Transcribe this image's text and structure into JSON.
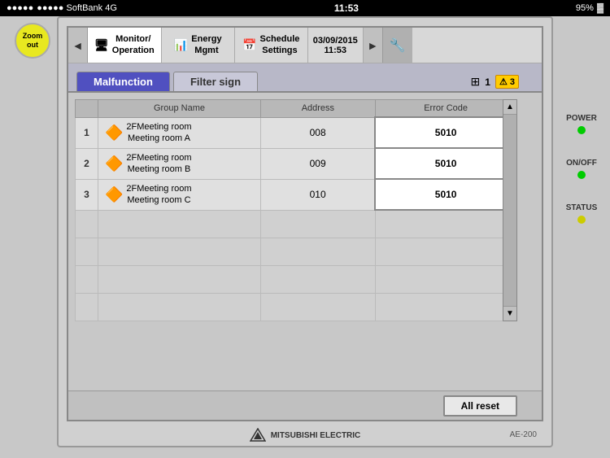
{
  "statusBar": {
    "carrier": "●●●●● SoftBank 4G",
    "time": "11:53",
    "battery": "95%"
  },
  "zoomOut": {
    "label": "Zoom\nout"
  },
  "nav": {
    "prevArrow": "◄",
    "nextArrow": "►",
    "tabs": [
      {
        "id": "monitor",
        "icon": "🖥",
        "label": "Monitor/\nOperation"
      },
      {
        "id": "energy",
        "icon": "📊",
        "label": "Energy\nMgmt"
      },
      {
        "id": "schedule",
        "icon": "📅",
        "label": "Schedule\nSettings"
      }
    ],
    "date": "03/09/2015",
    "time": "11:53",
    "wrenchIcon": "🔧"
  },
  "subTabs": {
    "tabs": [
      {
        "id": "malfunction",
        "label": "Malfunction",
        "active": true
      },
      {
        "id": "filtersign",
        "label": "Filter sign",
        "active": false
      }
    ],
    "gridIcon": "⊞",
    "gridCount": "1",
    "warningIcon": "⚠",
    "warningCount": "3"
  },
  "table": {
    "headers": [
      "Group Name",
      "Address",
      "Error Code"
    ],
    "rows": [
      {
        "num": "1",
        "groupLine1": "2FMeeting room",
        "groupLine2": "Meeting room A",
        "address": "008",
        "errorCode": "5010",
        "hasWarning": true
      },
      {
        "num": "2",
        "groupLine1": "2FMeeting room",
        "groupLine2": "Meeting room B",
        "address": "009",
        "errorCode": "5010",
        "hasWarning": true
      },
      {
        "num": "3",
        "groupLine1": "2FMeeting room",
        "groupLine2": "Meeting room C",
        "address": "010",
        "errorCode": "5010",
        "hasWarning": true
      }
    ],
    "emptyRows": 4
  },
  "buttons": {
    "allReset": "All reset"
  },
  "footer": {
    "brand": "MITSUBISHI\nELECTRIC",
    "model": "AE-200"
  },
  "indicators": {
    "power": {
      "label": "POWER",
      "color": "#00cc00"
    },
    "onoff": {
      "label": "ON/OFF",
      "color": "#00cc00"
    },
    "status": {
      "label": "STATUS",
      "color": "#cccc00"
    }
  }
}
